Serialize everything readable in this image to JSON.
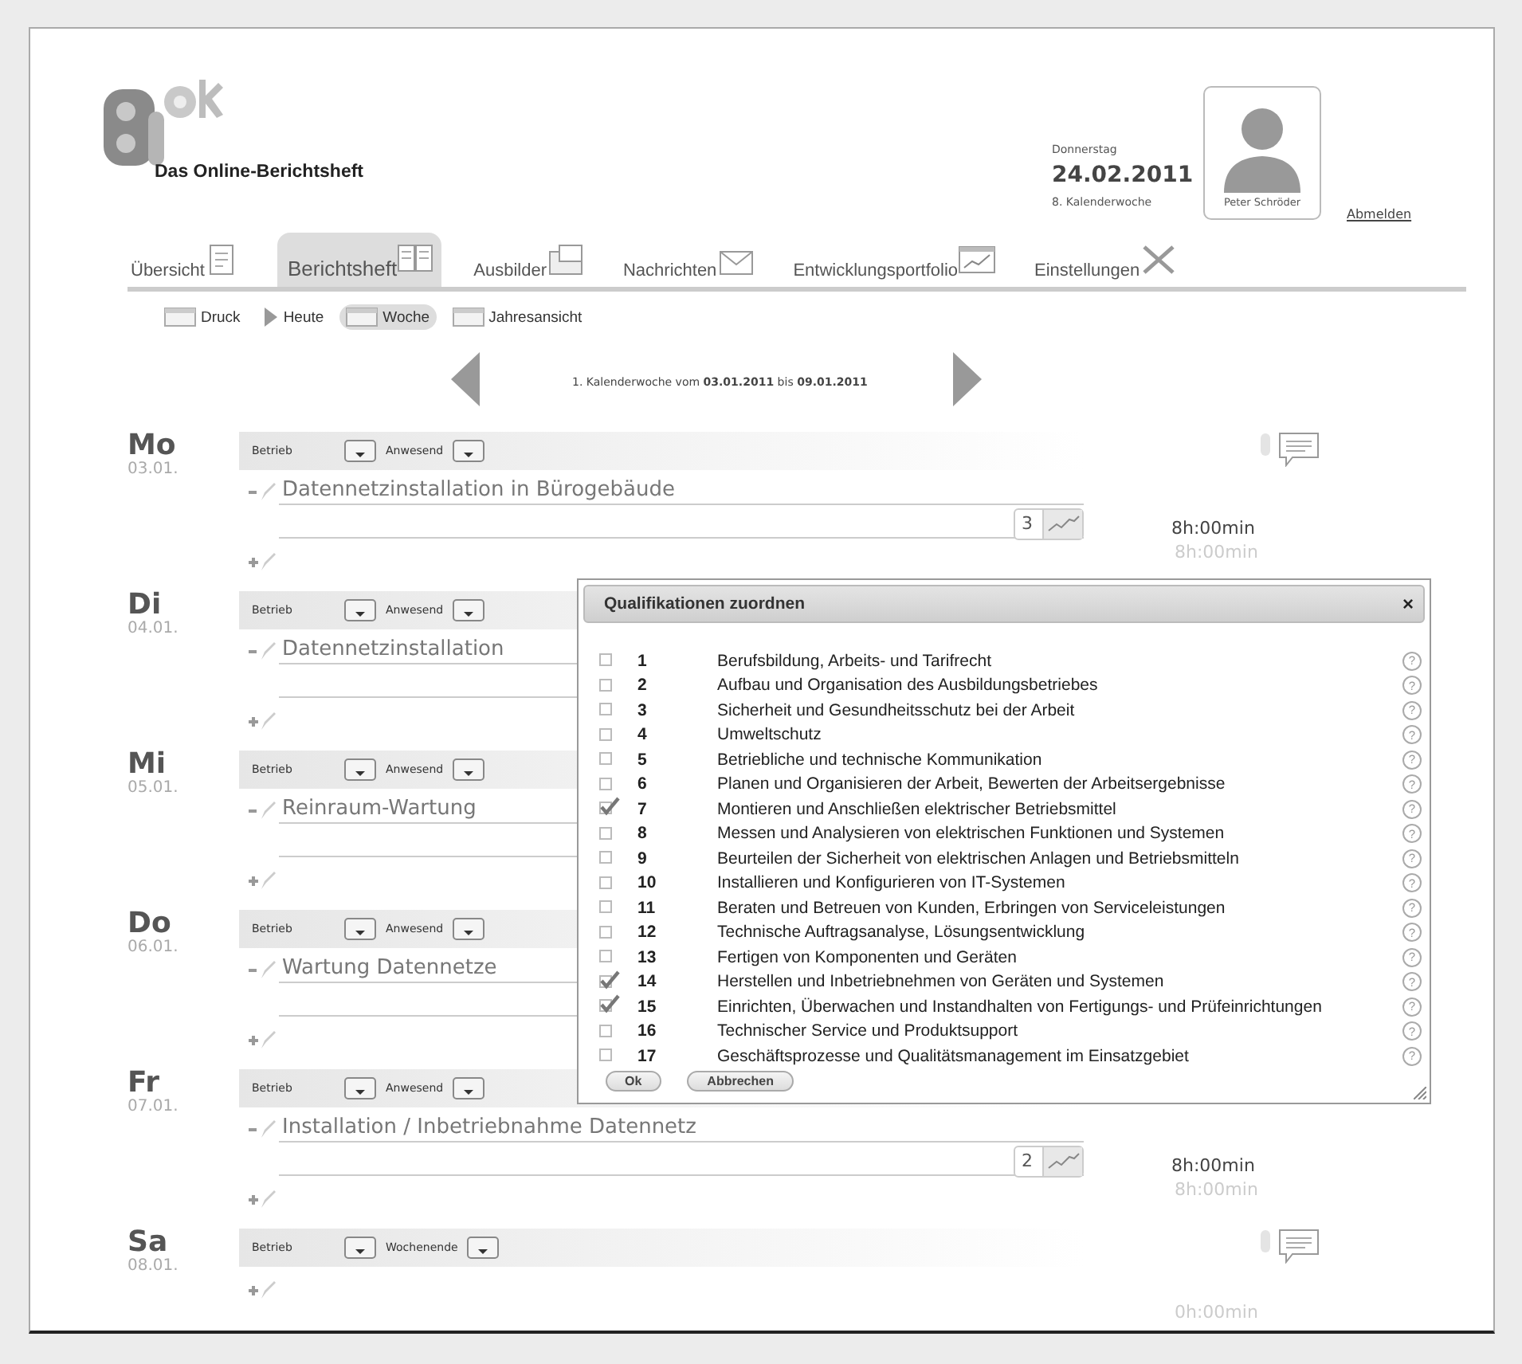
{
  "header": {
    "title": "Das Online-Berichtsheft",
    "weekday": "Donnerstag",
    "date": "24.02.2011",
    "week": "8. Kalenderwoche",
    "user": "Peter Schröder",
    "logout": "Abmelden"
  },
  "tabs": [
    {
      "label": "Übersicht",
      "selected": false
    },
    {
      "label": "Berichtsheft",
      "selected": true
    },
    {
      "label": "Ausbilder",
      "selected": false
    },
    {
      "label": "Nachrichten",
      "selected": false
    },
    {
      "label": "Entwicklungsportfolio",
      "selected": false
    },
    {
      "label": "Einstellungen",
      "selected": false
    }
  ],
  "toolbar": [
    {
      "label": "Druck",
      "selected": false
    },
    {
      "label": "Heute",
      "selected": false
    },
    {
      "label": "Woche",
      "selected": true
    },
    {
      "label": "Jahresansicht",
      "selected": false
    }
  ],
  "week_nav": {
    "title": "1. Kalenderwoche vom **03.01.2011** bis **09.01.2011**"
  },
  "days": [
    {
      "day": "Mo",
      "date": "03.01.",
      "place": "Betrieb",
      "status": "Anwesend",
      "notes": true,
      "entries": [
        {
          "text": "Datennetzinstallation in Bürogebäude",
          "count": "3"
        }
      ],
      "hours": "8h:00min",
      "hours_target": "8h:00min"
    },
    {
      "day": "Di",
      "date": "04.01.",
      "place": "Betrieb",
      "status": "Anwesend",
      "notes": false,
      "entries": [
        {
          "text": "Datennetzinstallation"
        }
      ]
    },
    {
      "day": "Mi",
      "date": "05.01.",
      "place": "Betrieb",
      "status": "Anwesend",
      "notes": false,
      "entries": [
        {
          "text": "Reinraum-Wartung"
        }
      ]
    },
    {
      "day": "Do",
      "date": "06.01.",
      "place": "Betrieb",
      "status": "Anwesend",
      "notes": false,
      "entries": [
        {
          "text": "Wartung Datennetze"
        }
      ]
    },
    {
      "day": "Fr",
      "date": "07.01.",
      "place": "Betrieb",
      "status": "Anwesend",
      "notes": false,
      "entries": [
        {
          "text": "Installation / Inbetriebnahme Datennetz",
          "count": "2"
        }
      ],
      "hours": "8h:00min",
      "hours_target": "8h:00min"
    },
    {
      "day": "Sa",
      "date": "08.01.",
      "place": "Betrieb",
      "status": "Wochenende",
      "notes": true,
      "hours_target": "0h:00min"
    }
  ],
  "dialog": {
    "title": "Qualifikationen zuordnen",
    "close": "×",
    "help": "?",
    "items": [
      {
        "number": "1",
        "text": "Berufsbildung, Arbeits- und Tarifrecht",
        "checked": false
      },
      {
        "number": "2",
        "text": "Aufbau und Organisation des Ausbildungsbetriebes",
        "checked": false
      },
      {
        "number": "3",
        "text": "Sicherheit und Gesundheitsschutz bei der Arbeit",
        "checked": false
      },
      {
        "number": "4",
        "text": "Umweltschutz",
        "checked": false
      },
      {
        "number": "5",
        "text": "Betriebliche und technische Kommunikation",
        "checked": false
      },
      {
        "number": "6",
        "text": "Planen und Organisieren der Arbeit, Bewerten der Arbeitsergebnisse",
        "checked": false
      },
      {
        "number": "7",
        "text": "Montieren und Anschließen elektrischer Betriebsmittel",
        "checked": true
      },
      {
        "number": "8",
        "text": "Messen und Analysieren von elektrischen Funktionen und Systemen",
        "checked": false
      },
      {
        "number": "9",
        "text": "Beurteilen der Sicherheit von elektrischen Anlagen und Betriebsmitteln",
        "checked": false
      },
      {
        "number": "10",
        "text": "Installieren und Konfigurieren von IT-Systemen",
        "checked": false
      },
      {
        "number": "11",
        "text": "Beraten und Betreuen von Kunden, Erbringen von Serviceleistungen",
        "checked": false
      },
      {
        "number": "12",
        "text": "Technische Auftragsanalyse, Lösungsentwicklung",
        "checked": false
      },
      {
        "number": "13",
        "text": "Fertigen von Komponenten und Geräten",
        "checked": false
      },
      {
        "number": "14",
        "text": "Herstellen und Inbetriebnehmen von Geräten und Systemen",
        "checked": true
      },
      {
        "number": "15",
        "text": "Einrichten, Überwachen und Instandhalten von Fertigungs- und Prüfeinrichtungen",
        "checked": true
      },
      {
        "number": "16",
        "text": "Technischer Service und Produktsupport",
        "checked": false
      },
      {
        "number": "17",
        "text": "Geschäftsprozesse und Qualitätsmanagement im Einsatzgebiet",
        "checked": false
      }
    ],
    "buttons": [
      "Ok",
      "Abbrechen"
    ]
  }
}
